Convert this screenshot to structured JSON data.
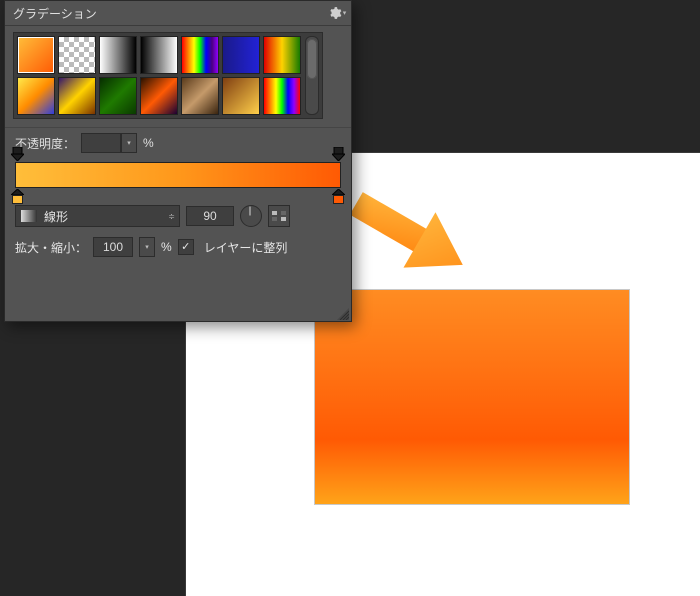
{
  "panel": {
    "title": "グラデーション",
    "menu_icon": "gear-icon",
    "opacity_label": "不透明度：",
    "opacity_value": "",
    "percent_symbol": "%",
    "type": {
      "label": "線形",
      "icon": "linear-gradient-icon"
    },
    "angle_value": "90",
    "scale_label": "拡大・縮小：",
    "scale_value": "100",
    "align_to_layer_checked": true,
    "align_to_layer_label": "レイヤーに整列"
  },
  "swatches": [
    {
      "css": "linear-gradient(135deg,#ffbe3a,#ff5a04)",
      "selected": true
    },
    {
      "checker": true
    },
    {
      "css": "linear-gradient(90deg,#ffffff,#000000)"
    },
    {
      "css": "linear-gradient(90deg,#000000,#ffffff)"
    },
    {
      "css": "linear-gradient(to right,#ff0000,#ff7f00,#ffff00,#00ff00,#0000ff,#4b0082,#8f00ff)"
    },
    {
      "css": "linear-gradient(90deg,#1a1a8a,#2222d6)"
    },
    {
      "css": "linear-gradient(90deg,#e10000,#ffd200,#167a00)"
    },
    {
      "css": "linear-gradient(135deg,#ffe94a,#ff8c00,#2e3edd)"
    },
    {
      "css": "linear-gradient(135deg,#35166b,#ffd200,#7a3300)"
    },
    {
      "css": "linear-gradient(135deg,#062e00,#1f7a00,#0a3a00)"
    },
    {
      "css": "linear-gradient(135deg,#2b1200,#ff5a04,#1a0033)"
    },
    {
      "css": "linear-gradient(135deg,#5a3b1c,#c59a6a,#3a240f)"
    },
    {
      "css": "linear-gradient(135deg,#803f12,#ffcf4a)"
    },
    {
      "css": "linear-gradient(to right,#ff0000,#ff7f00,#ffff00,#00ff00,#0000ff,#8f00ff,#ff0000)"
    }
  ],
  "gradient_editor": {
    "opacity_stops": [
      "left",
      "right"
    ],
    "color_stops": [
      {
        "pos": "left",
        "color": "#ffbe3a"
      },
      {
        "pos": "right",
        "color": "#ff5a04"
      }
    ]
  },
  "preview_rect": {
    "gradient_css": "linear-gradient(to bottom,#ff8c22 0%,#ff7414 35%,#ff5a04 70%,#ffa319 100%)"
  },
  "arrow_color": "#ff9a1c"
}
